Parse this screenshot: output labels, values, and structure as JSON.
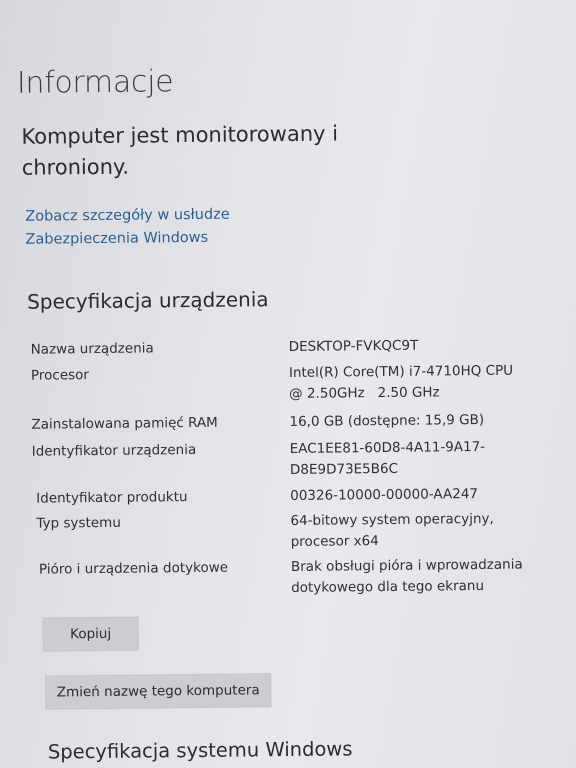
{
  "page": {
    "title": "Informacje"
  },
  "security": {
    "status": "Komputer jest monitorowany i chroniony.",
    "link": "Zobacz szczegóły w usłudze Zabezpieczenia Windows"
  },
  "device_specs": {
    "heading": "Specyfikacja urządzenia",
    "rows": [
      {
        "label": "Nazwa urządzenia",
        "value": "DESKTOP-FVKQC9T"
      },
      {
        "label": "Procesor",
        "value": "Intel(R) Core(TM) i7-4710HQ CPU @ 2.50GHz   2.50 GHz"
      },
      {
        "label": "Zainstalowana pamięć RAM",
        "value": "16,0 GB (dostępne: 15,9 GB)"
      },
      {
        "label": "Identyfikator urządzenia",
        "value": "EAC1EE81-60D8-4A11-9A17-D8E9D73E5B6C"
      },
      {
        "label": "Identyfikator produktu",
        "value": "00326-10000-00000-AA247"
      },
      {
        "label": "Typ systemu",
        "value": "64-bitowy system operacyjny, procesor x64"
      },
      {
        "label": "Pióro i urządzenia dotykowe",
        "value": "Brak obsługi pióra i wprowadzania dotykowego dla tego ekranu"
      }
    ]
  },
  "buttons": {
    "copy": "Kopiuj",
    "rename": "Zmień nazwę tego komputera"
  },
  "windows_specs": {
    "heading": "Specyfikacja systemu Windows"
  }
}
